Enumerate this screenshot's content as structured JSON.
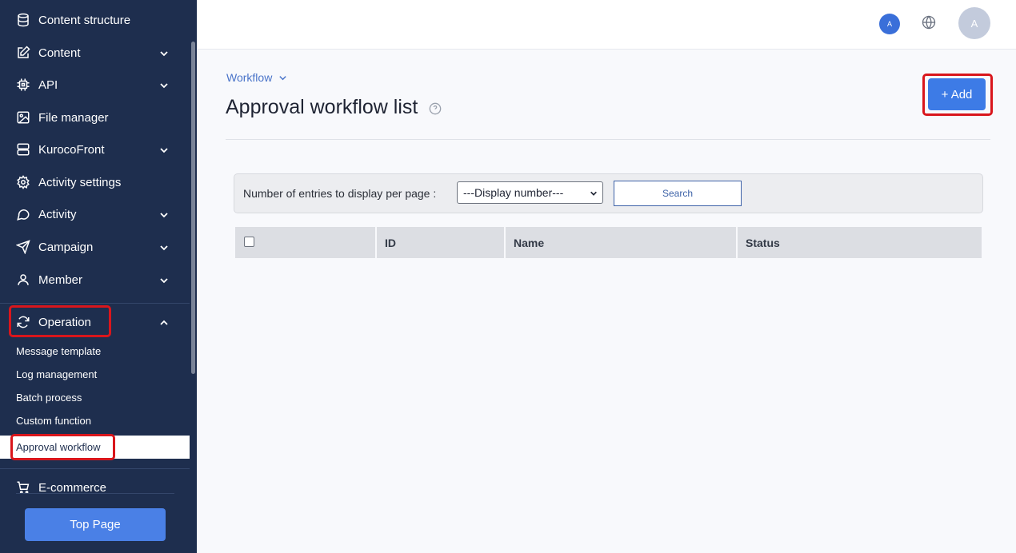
{
  "sidebar": {
    "items": [
      {
        "label": "Content structure",
        "icon": "database-icon"
      },
      {
        "label": "Content",
        "icon": "edit-icon"
      },
      {
        "label": "API",
        "icon": "chip-icon"
      },
      {
        "label": "File manager",
        "icon": "image-icon"
      },
      {
        "label": "KurocoFront",
        "icon": "server-icon"
      },
      {
        "label": "Activity settings",
        "icon": "gear-icon"
      },
      {
        "label": "Activity",
        "icon": "chat-icon"
      },
      {
        "label": "Campaign",
        "icon": "send-icon"
      },
      {
        "label": "Member",
        "icon": "user-icon"
      },
      {
        "label": "Operation",
        "icon": "refresh-icon"
      }
    ],
    "sub_items": [
      {
        "label": "Message template"
      },
      {
        "label": "Log management"
      },
      {
        "label": "Batch process"
      },
      {
        "label": "Custom function"
      },
      {
        "label": "Approval workflow"
      }
    ],
    "ecommerce_label": "E-commerce",
    "top_page_label": "Top Page"
  },
  "header": {
    "small_avatar_letter": "A",
    "avatar_letter": "A"
  },
  "main": {
    "breadcrumb": "Workflow",
    "title": "Approval workflow list",
    "add_label": "+ Add",
    "filter": {
      "label": "Number of entries to display per page :",
      "selected": "---Display number---",
      "search_label": "Search"
    },
    "table": {
      "columns": [
        "",
        "ID",
        "Name",
        "Status"
      ]
    }
  },
  "colors": {
    "sidebar_bg": "#1e2e4e",
    "accent": "#3d7be6",
    "highlight": "#d9161c"
  }
}
